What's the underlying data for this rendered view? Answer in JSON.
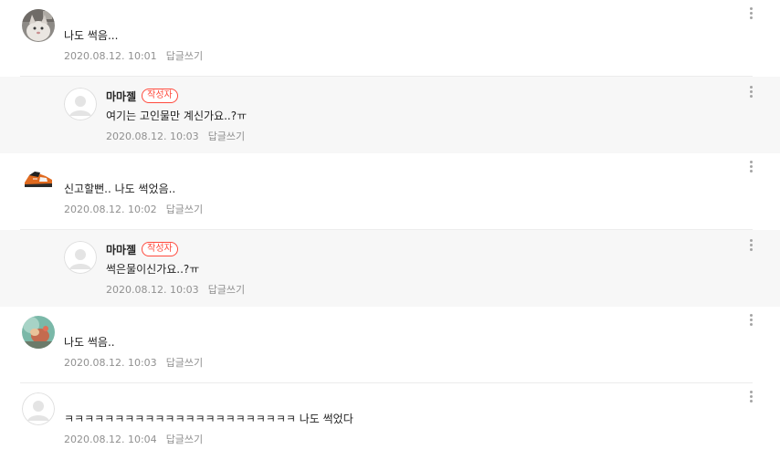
{
  "comments": [
    {
      "kind": "top",
      "avatar": "cat-photo-avatar",
      "author": "",
      "is_author": false,
      "text": "나도 썩음...",
      "date": "2020.08.12. 10:01",
      "reply_label": "답글쓰기"
    },
    {
      "kind": "reply",
      "avatar": "default-avatar",
      "author": "마마젤",
      "is_author": true,
      "badge": "작성자",
      "text": "여기는 고인물만 계신가요..?ㅠ",
      "date": "2020.08.12. 10:03",
      "reply_label": "답글쓰기"
    },
    {
      "kind": "top",
      "avatar": "sneaker-photo-avatar",
      "author": "",
      "is_author": false,
      "text": "신고할뻔.. 나도 썩었음..",
      "date": "2020.08.12. 10:02",
      "reply_label": "답글쓰기"
    },
    {
      "kind": "reply",
      "avatar": "default-avatar",
      "author": "마마젤",
      "is_author": true,
      "badge": "작성자",
      "text": "썩은물이신가요..?ㅠ",
      "date": "2020.08.12. 10:03",
      "reply_label": "답글쓰기"
    },
    {
      "kind": "top",
      "avatar": "figure-photo-avatar",
      "author": "",
      "is_author": false,
      "text": "나도 썩음..",
      "date": "2020.08.12. 10:03",
      "reply_label": "답글쓰기"
    },
    {
      "kind": "top",
      "avatar": "default-avatar",
      "author": "",
      "is_author": false,
      "text": "ㅋㅋㅋㅋㅋㅋㅋㅋㅋㅋㅋㅋㅋㅋㅋㅋㅋㅋㅋㅋㅋㅋㅋ 나도 썩었다",
      "date": "2020.08.12. 10:04",
      "reply_label": "답글쓰기"
    }
  ],
  "colors": {
    "badge": "#ff4a3d",
    "meta_text": "#909090",
    "reply_background": "#f7f7f7",
    "divider": "#ececec"
  }
}
